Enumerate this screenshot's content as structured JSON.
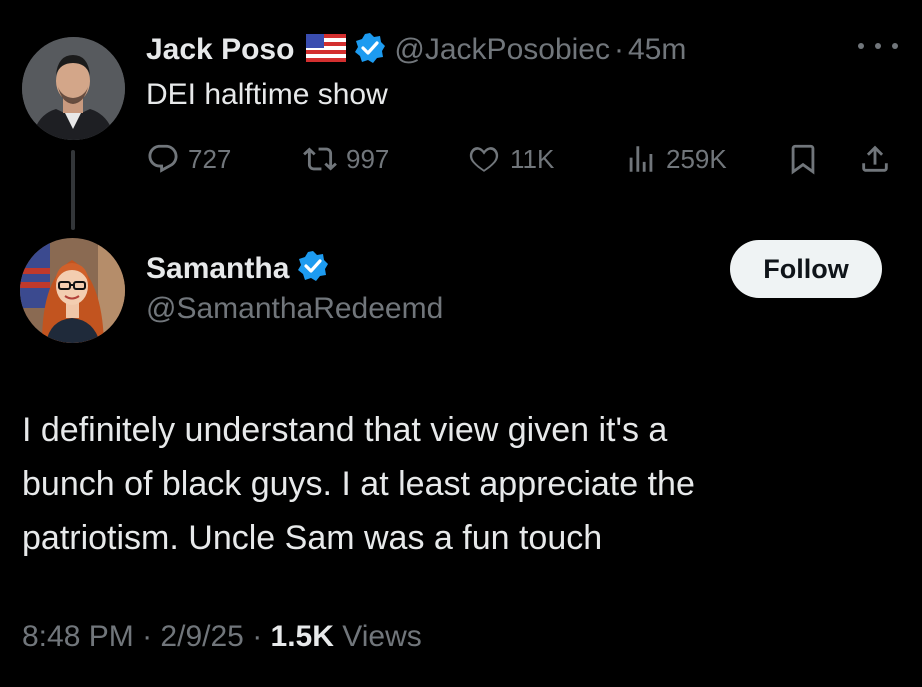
{
  "original_post": {
    "author_name": "Jack Poso",
    "author_handle": "@JackPosobiec",
    "time": "45m",
    "text": "DEI halftime show",
    "flag_icon": "us-flag-icon",
    "stats": {
      "replies": "727",
      "reposts": "997",
      "likes": "11K",
      "views": "259K"
    }
  },
  "reply": {
    "author_name": "Samantha",
    "author_handle": "@SamanthaRedeemd",
    "follow_label": "Follow",
    "text_lines": [
      "I definitely understand that view given it's a",
      "bunch of black guys. I at least appreciate the",
      "patriotism. Uncle Sam was a fun touch"
    ],
    "timestamp": "8:48 PM",
    "date": "2/9/25",
    "views_count": "1.5K",
    "views_label": "Views"
  },
  "separator": "·",
  "colors": {
    "background": "#000000",
    "primary_text": "#e7e9ea",
    "secondary_text": "#71767b",
    "verified_blue": "#1d9bf0",
    "follow_button_bg": "#eff3f4"
  }
}
